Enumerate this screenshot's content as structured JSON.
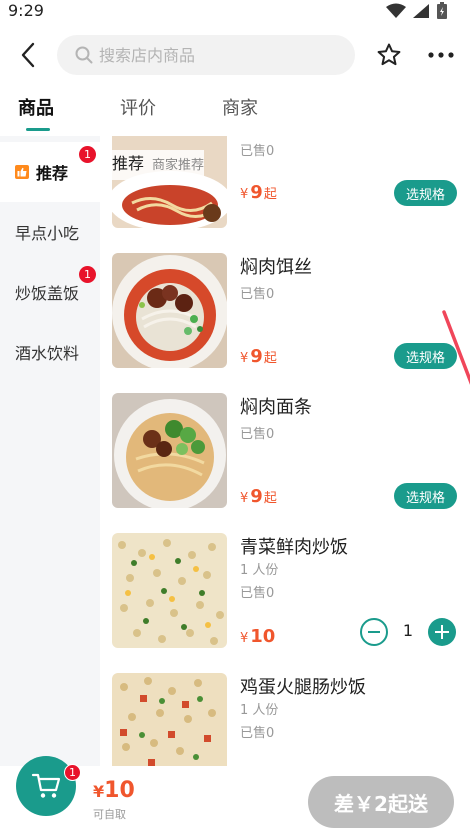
{
  "status": {
    "time": "9:29"
  },
  "header": {
    "search_placeholder": "搜索店内商品"
  },
  "tabs": [
    {
      "label": "商品",
      "active": true
    },
    {
      "label": "评价",
      "active": false
    },
    {
      "label": "商家",
      "active": false
    }
  ],
  "sidebar": {
    "items": [
      {
        "label": "推荐",
        "active": true,
        "badge": "1"
      },
      {
        "label": "早点小吃",
        "active": false,
        "badge": ""
      },
      {
        "label": "炒饭盖饭",
        "active": false,
        "badge": "1"
      },
      {
        "label": "酒水饮料",
        "active": false,
        "badge": ""
      }
    ]
  },
  "section": {
    "title": "推荐",
    "subtitle": "商家推荐"
  },
  "items": [
    {
      "name": "",
      "sold": "已售0",
      "price": "9",
      "price_suffix": "起",
      "currency": "¥",
      "action": "选规格"
    },
    {
      "name": "焖肉饵丝",
      "sold": "已售0",
      "price": "9",
      "price_suffix": "起",
      "currency": "¥",
      "action": "选规格"
    },
    {
      "name": "焖肉面条",
      "sold": "已售0",
      "price": "9",
      "price_suffix": "起",
      "currency": "¥",
      "action": "选规格"
    },
    {
      "name": "青菜鲜肉炒饭",
      "portion": "1 人份",
      "sold": "已售0",
      "price": "10",
      "currency": "¥",
      "quantity": "1"
    },
    {
      "name": "鸡蛋火腿肠炒饭",
      "portion": "1 人份",
      "sold": "已售0"
    }
  ],
  "cart": {
    "badge": "1",
    "total_currency": "¥",
    "total": "10",
    "pickup": "可自取",
    "checkout_label": "差￥2起送"
  },
  "colors": {
    "accent": "#1a9b8c",
    "price": "#f0562d",
    "badge": "#e8132b",
    "annotation_arrow": "#f0465a"
  }
}
